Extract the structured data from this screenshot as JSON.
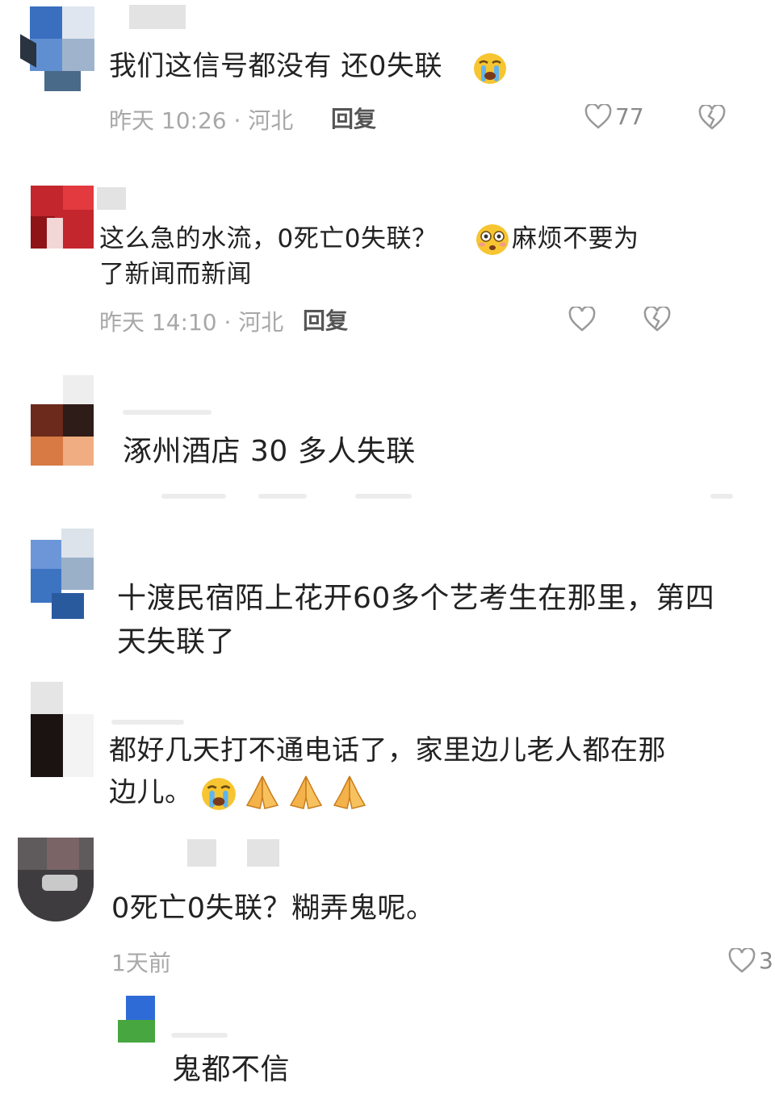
{
  "comments": [
    {
      "text": "我们这信号都没有 还0失联",
      "time": "昨天 10:26 · 河北",
      "reply": "回复",
      "likes": "77"
    },
    {
      "text1": "这么急的水流，0死亡0失联？",
      "text2": "麻烦不要为",
      "text3": "了新闻而新闻",
      "time": "昨天 14:10 · 河北",
      "reply": "回复"
    },
    {
      "text": "涿州酒店 30 多人失联"
    },
    {
      "text1": "十渡民宿陌上花开60多个艺考生在那里，第四",
      "text2": "天失联了"
    },
    {
      "text1": "都好几天打不通电话了，家里边儿老人都在那",
      "text2": "边儿。"
    },
    {
      "text": "0死亡0失联？糊弄鬼呢。",
      "time": "1天前",
      "likes": "3"
    },
    {
      "text": "鬼都不信"
    }
  ],
  "icons": {
    "like": "heart-icon",
    "dislike": "broken-heart-icon",
    "crying": "crying-face-emoji",
    "flushed": "flushed-face-emoji",
    "pray": "folded-hands-emoji"
  },
  "colors": {
    "text": "#222222",
    "meta": "#a8a8a8",
    "icon": "#9a9a9a"
  }
}
